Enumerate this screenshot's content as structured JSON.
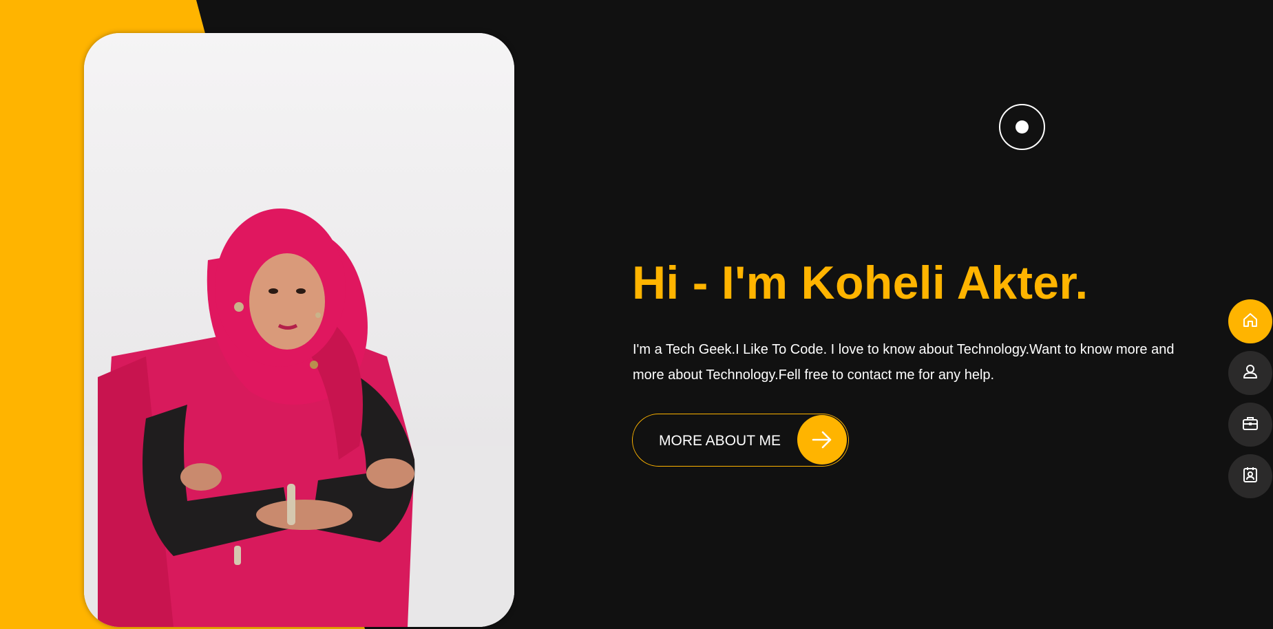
{
  "hero": {
    "title": "Hi - I'm Koheli Akter.",
    "description": "I'm a Tech Geek.I Like To Code. I love to know about Technology.Want to know more and more about Technology.Fell free to contact me for any help.",
    "button_label": "MORE ABOUT ME"
  },
  "colors": {
    "accent": "#ffb400",
    "background": "#111111",
    "text": "#ffffff",
    "nav_inactive": "#2b2a2a"
  },
  "side_nav": {
    "items": [
      {
        "icon": "home-icon",
        "active": true
      },
      {
        "icon": "user-icon",
        "active": false
      },
      {
        "icon": "briefcase-icon",
        "active": false
      },
      {
        "icon": "contact-card-icon",
        "active": false
      }
    ]
  },
  "photo": {
    "subject": "portrait-photo"
  }
}
